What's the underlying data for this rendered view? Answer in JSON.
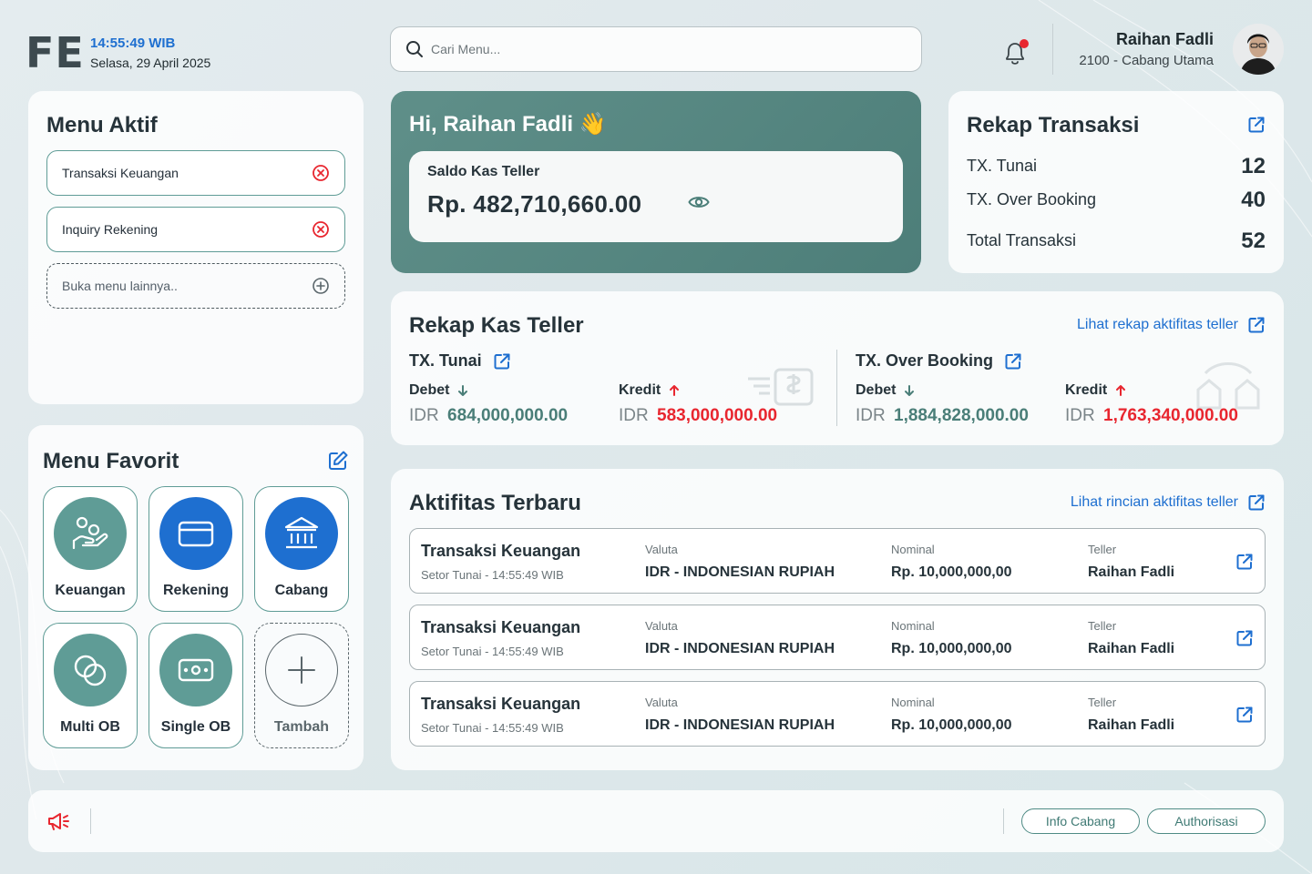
{
  "header": {
    "logo": "FE",
    "time": "14:55:49 WIB",
    "date": "Selasa, 29 April 2025",
    "search_placeholder": "Cari Menu...",
    "user_name": "Raihan Fadli",
    "user_branch": "2100 - Cabang Utama"
  },
  "menu_aktif": {
    "title": "Menu Aktif",
    "items": [
      "Transaksi Keuangan",
      "Inquiry Rekening"
    ],
    "more_label": "Buka menu lainnya.."
  },
  "menu_favorit": {
    "title": "Menu Favorit",
    "items": [
      {
        "label": "Keuangan",
        "icon": "hand-coins-icon"
      },
      {
        "label": "Rekening",
        "icon": "card-icon"
      },
      {
        "label": "Cabang",
        "icon": "bank-icon"
      },
      {
        "label": "Multi OB",
        "icon": "overlap-circles-icon"
      },
      {
        "label": "Single OB",
        "icon": "cash-icon"
      },
      {
        "label": "Tambah",
        "icon": "plus-icon"
      }
    ]
  },
  "hero": {
    "greeting": "Hi, Raihan Fadli",
    "wave": "👋",
    "saldo_label": "Saldo Kas Teller",
    "saldo_value": "Rp. 482,710,660.00"
  },
  "rekap_transaksi": {
    "title": "Rekap Transaksi",
    "rows": [
      {
        "label": "TX. Tunai",
        "value": "12"
      },
      {
        "label": "TX. Over Booking",
        "value": "40"
      },
      {
        "label": "Total Transaksi",
        "value": "52"
      }
    ]
  },
  "rekap_kas": {
    "title": "Rekap Kas Teller",
    "link": "Lihat rekap aktifitas teller",
    "tunai": {
      "title": "TX. Tunai",
      "debet_label": "Debet",
      "debet_cur": "IDR",
      "debet_value": "684,000,000.00",
      "kredit_label": "Kredit",
      "kredit_cur": "IDR",
      "kredit_value": "583,000,000.00"
    },
    "ob": {
      "title": "TX. Over Booking",
      "debet_label": "Debet",
      "debet_cur": "IDR",
      "debet_value": "1,884,828,000.00",
      "kredit_label": "Kredit",
      "kredit_cur": "IDR",
      "kredit_value": "1,763,340,000.00"
    }
  },
  "aktifitas": {
    "title": "Aktifitas Terbaru",
    "link": "Lihat rincian aktifitas teller",
    "col_valuta": "Valuta",
    "col_nominal": "Nominal",
    "col_teller": "Teller",
    "rows": [
      {
        "title": "Transaksi Keuangan",
        "sub": "Setor Tunai - 14:55:49 WIB",
        "valuta": "IDR - INDONESIAN RUPIAH",
        "nominal": "Rp. 10,000,000,00",
        "teller": "Raihan Fadli"
      },
      {
        "title": "Transaksi Keuangan",
        "sub": "Setor Tunai - 14:55:49 WIB",
        "valuta": "IDR - INDONESIAN RUPIAH",
        "nominal": "Rp. 10,000,000,00",
        "teller": "Raihan Fadli"
      },
      {
        "title": "Transaksi Keuangan",
        "sub": "Setor Tunai - 14:55:49 WIB",
        "valuta": "IDR - INDONESIAN RUPIAH",
        "nominal": "Rp. 10,000,000,00",
        "teller": "Raihan Fadli"
      }
    ]
  },
  "footer": {
    "btn_info": "Info Cabang",
    "btn_auth": "Authorisasi"
  },
  "colors": {
    "teal": "#5f9c96",
    "blue": "#1e6fd0",
    "red": "#e8262f",
    "green_value": "#4a7e78"
  }
}
